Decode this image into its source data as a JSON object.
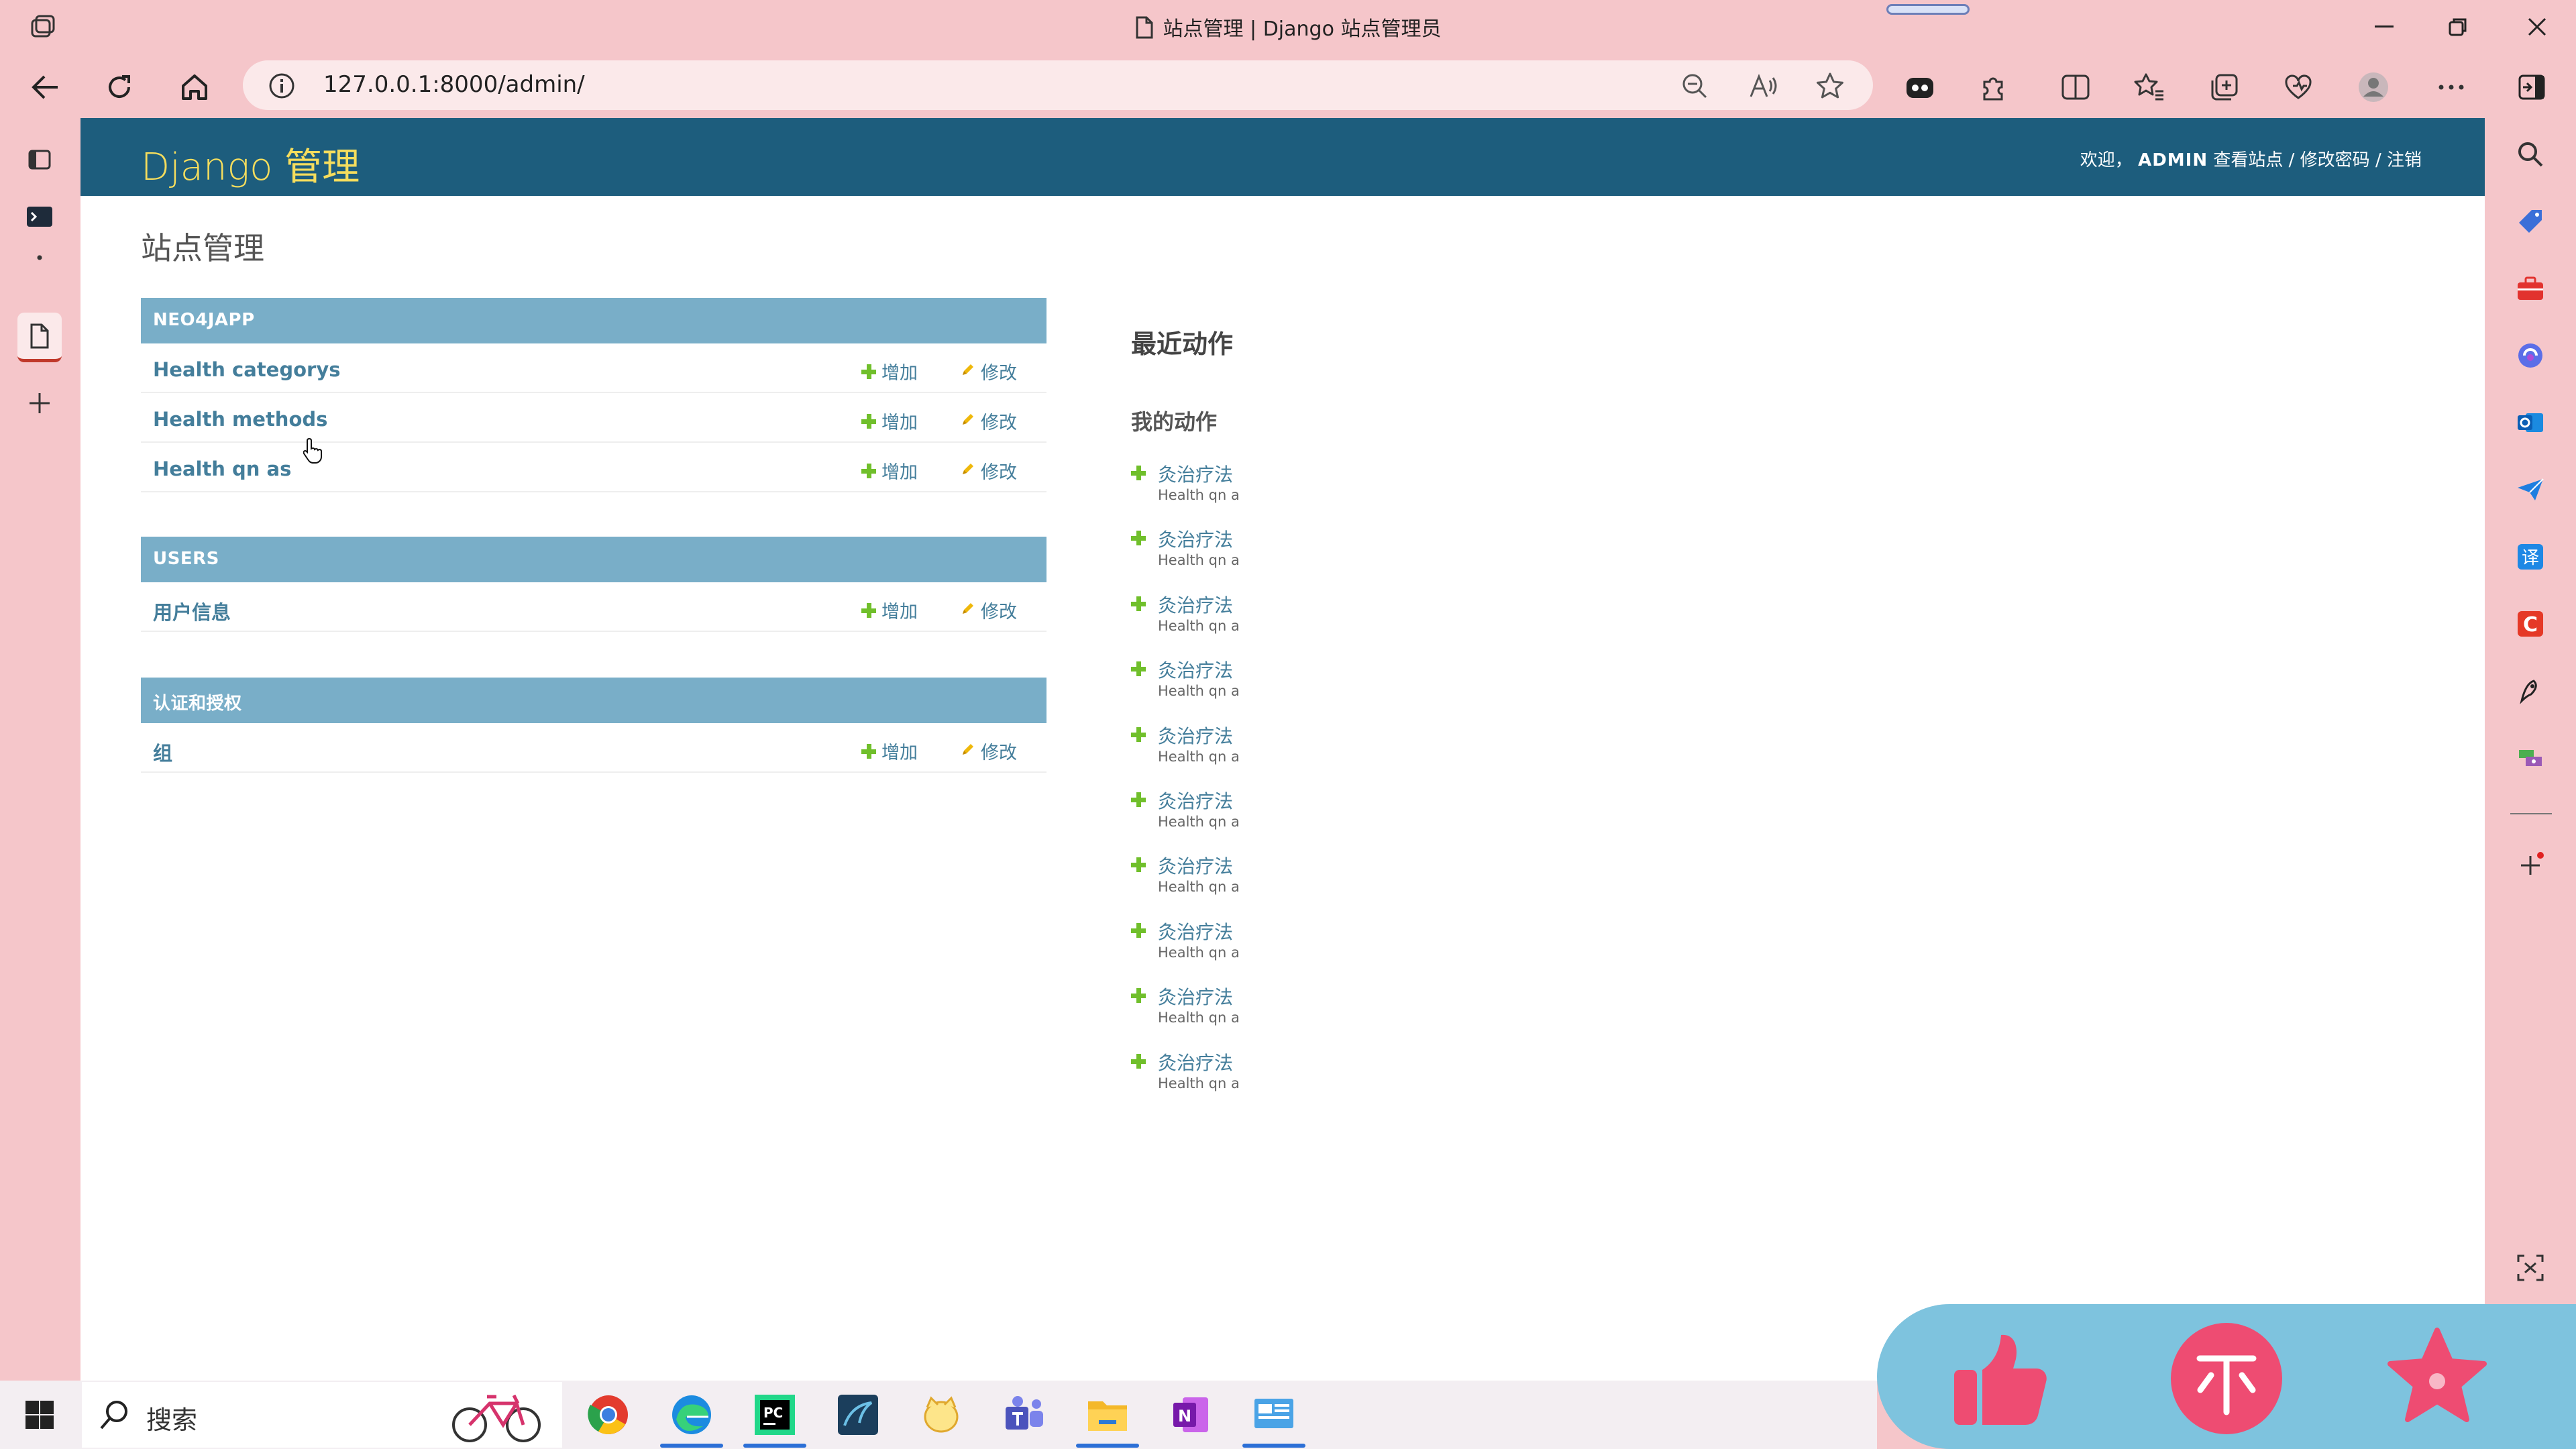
{
  "browser": {
    "tab_title": "站点管理 | Django 站点管理员",
    "url": "127.0.0.1:8000/admin/"
  },
  "header": {
    "brand": "Django 管理",
    "welcome": "欢迎，",
    "username": "ADMIN",
    "view_site": "查看站点",
    "change_password": "修改密码",
    "logout": "注销",
    "sep": " / "
  },
  "site_title": "站点管理",
  "modules": [
    {
      "caption": "NEO4JAPP",
      "models": [
        {
          "name": "Health categorys",
          "add": "增加",
          "change": "修改"
        },
        {
          "name": "Health methods",
          "add": "增加",
          "change": "修改"
        },
        {
          "name": "Health qn as",
          "add": "增加",
          "change": "修改"
        }
      ]
    },
    {
      "caption": "USERS",
      "models": [
        {
          "name": "用户信息",
          "add": "增加",
          "change": "修改"
        }
      ]
    },
    {
      "caption": "认证和授权",
      "models": [
        {
          "name": "组",
          "add": "增加",
          "change": "修改"
        }
      ]
    }
  ],
  "recent": {
    "title": "最近动作",
    "my_actions": "我的动作",
    "items": [
      {
        "title": "灸治疗法",
        "type": "Health qn a"
      },
      {
        "title": "灸治疗法",
        "type": "Health qn a"
      },
      {
        "title": "灸治疗法",
        "type": "Health qn a"
      },
      {
        "title": "灸治疗法",
        "type": "Health qn a"
      },
      {
        "title": "灸治疗法",
        "type": "Health qn a"
      },
      {
        "title": "灸治疗法",
        "type": "Health qn a"
      },
      {
        "title": "灸治疗法",
        "type": "Health qn a"
      },
      {
        "title": "灸治疗法",
        "type": "Health qn a"
      },
      {
        "title": "灸治疗法",
        "type": "Health qn a"
      },
      {
        "title": "灸治疗法",
        "type": "Health qn a"
      }
    ]
  },
  "taskbar": {
    "search_placeholder": "搜索",
    "apps": [
      "chrome-icon",
      "edge-icon",
      "pycharm-icon",
      "mysql-workbench-icon",
      "navicat-icon",
      "teams-icon",
      "file-explorer-icon",
      "onenote-icon",
      "control-panel-icon"
    ]
  },
  "reactions": [
    "thumbs-up-icon",
    "coin-icon",
    "star-icon"
  ],
  "colors": {
    "chrome_bg": "#f5c6ca",
    "header_bg": "#1d5d7d",
    "brand": "#f5dd5d",
    "module_caption": "#79aec8",
    "link": "#447e9b",
    "add_green": "#70bf2b",
    "reaction_panel": "#7ec3de",
    "reaction_pink": "#ee4c72"
  }
}
